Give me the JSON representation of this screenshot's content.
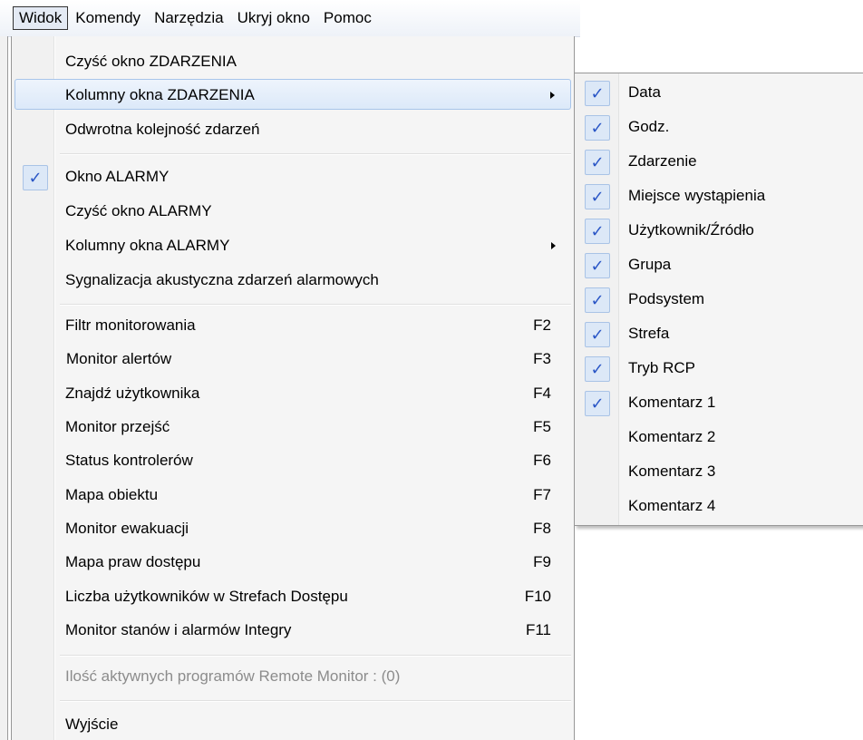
{
  "menubar": {
    "items": [
      "Widok",
      "Komendy",
      "Narzędzia",
      "Ukryj okno",
      "Pomoc"
    ]
  },
  "menu": {
    "items": [
      {
        "label": "Czyść okno ZDARZENIA"
      },
      {
        "label": "Kolumny okna ZDARZENIA",
        "submenu": true,
        "highlighted": true
      },
      {
        "label": "Odwrotna kolejność zdarzeń"
      },
      {
        "label": "Okno ALARMY",
        "checked": true
      },
      {
        "label": "Czyść okno ALARMY"
      },
      {
        "label": "Kolumny okna ALARMY",
        "submenu": true
      },
      {
        "label": "Sygnalizacja akustyczna zdarzeń alarmowych"
      },
      {
        "label": "Filtr monitorowania",
        "shortcut": "F2"
      },
      {
        "label": "Monitor alertów",
        "shortcut": "F3"
      },
      {
        "label": "Znajdź użytkownika",
        "shortcut": "F4"
      },
      {
        "label": "Monitor przejść",
        "shortcut": "F5"
      },
      {
        "label": "Status kontrolerów",
        "shortcut": "F6"
      },
      {
        "label": "Mapa obiektu",
        "shortcut": "F7"
      },
      {
        "label": "Monitor ewakuacji",
        "shortcut": "F8"
      },
      {
        "label": "Mapa praw dostępu",
        "shortcut": "F9"
      },
      {
        "label": "Liczba użytkowników w Strefach Dostępu",
        "shortcut": "F10"
      },
      {
        "label": "Monitor stanów i alarmów Integry",
        "shortcut": "F11"
      },
      {
        "label": "Ilość aktywnych programów Remote Monitor : (0)",
        "disabled": true
      },
      {
        "label": "Wyjście"
      }
    ]
  },
  "submenu": {
    "items": [
      {
        "label": "Data",
        "checked": true
      },
      {
        "label": "Godz.",
        "checked": true
      },
      {
        "label": "Zdarzenie",
        "checked": true
      },
      {
        "label": "Miejsce wystąpienia",
        "checked": true
      },
      {
        "label": "Użytkownik/Źródło",
        "checked": true
      },
      {
        "label": "Grupa",
        "checked": true
      },
      {
        "label": "Podsystem",
        "checked": true
      },
      {
        "label": "Strefa",
        "checked": true
      },
      {
        "label": "Tryb RCP",
        "checked": true
      },
      {
        "label": "Komentarz 1",
        "checked": true
      },
      {
        "label": "Komentarz 2",
        "checked": false
      },
      {
        "label": "Komentarz 3",
        "checked": false
      },
      {
        "label": "Komentarz 4",
        "checked": false
      }
    ]
  },
  "icons": {
    "check": "✓",
    "submenu_arrow": "chevron-right-icon"
  },
  "colors": {
    "check": "#2a56c6",
    "highlight": "#dce9f9",
    "disabled_text": "#8c8c8c"
  }
}
